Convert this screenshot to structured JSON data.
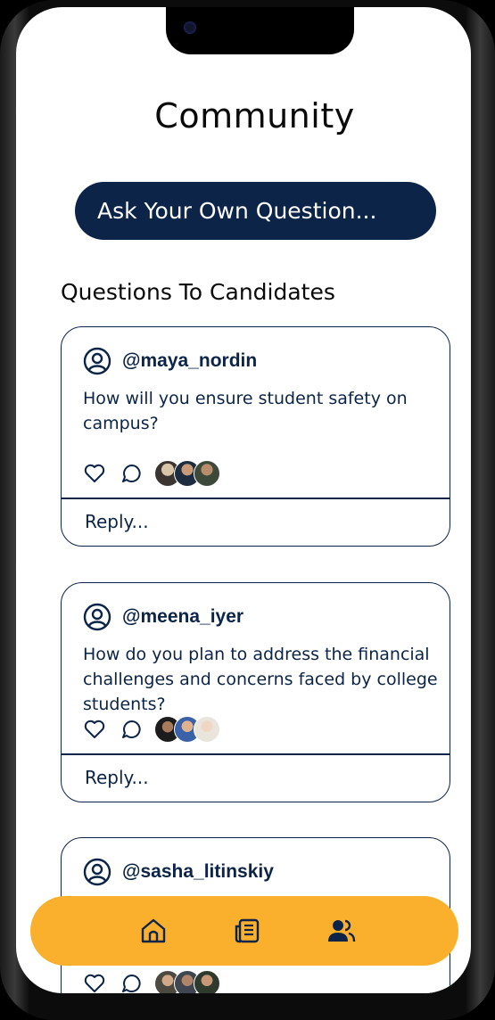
{
  "header": {
    "title": "Community"
  },
  "ask_button": {
    "label": "Ask Your Own Question..."
  },
  "section": {
    "title": "Questions To Candidates"
  },
  "questions": [
    {
      "username": "@maya_nordin",
      "text": "How will you ensure student safety on campus?",
      "reply_placeholder": "Reply..."
    },
    {
      "username": "@meena_iyer",
      "text": "How do you plan to address the financial challenges and concerns faced by college students?",
      "reply_placeholder": "Reply..."
    },
    {
      "username": "@sasha_litinskiy",
      "text": "",
      "reply_placeholder": ""
    }
  ],
  "bottom_nav": {
    "items": [
      {
        "icon": "home-icon"
      },
      {
        "icon": "newspaper-icon"
      },
      {
        "icon": "community-icon",
        "active": true
      }
    ]
  },
  "colors": {
    "primary": "#0b2447",
    "accent": "#fbb02d",
    "background": "#ffffff"
  }
}
